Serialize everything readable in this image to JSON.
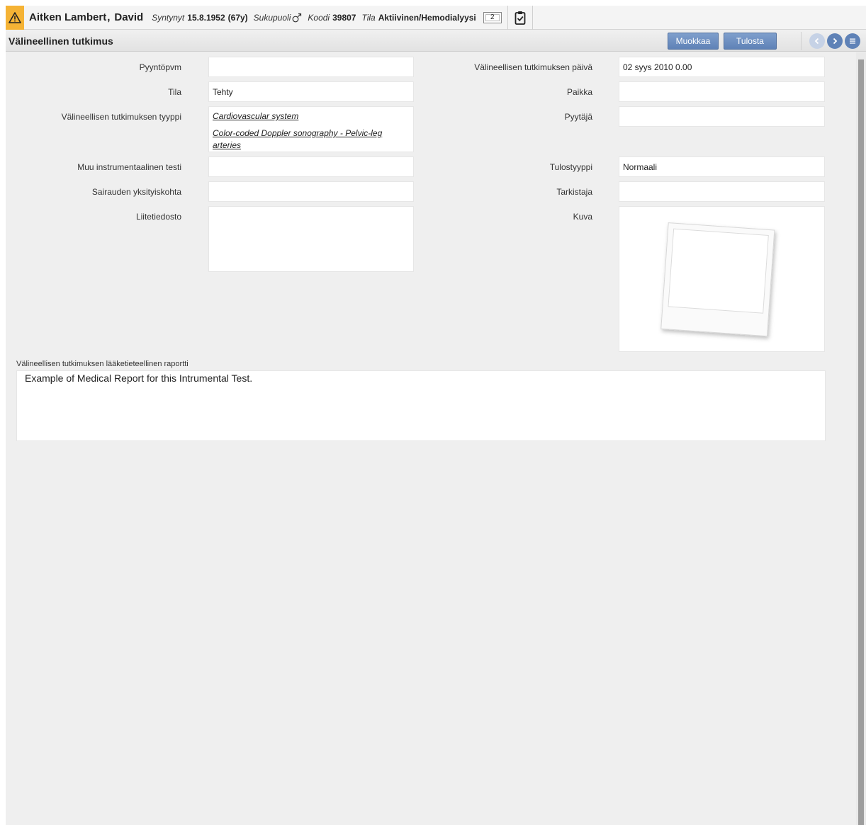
{
  "patient": {
    "name": "Aitken Lambert",
    "first_name": "David",
    "born_label": "Syntynyt",
    "born_value": "15.8.1952",
    "age": "(67y)",
    "sex_label": "Sukupuoli",
    "code_label": "Koodi",
    "code_value": "39807",
    "status_label": "Tila",
    "status_value": "Aktiivinen/Hemodialyysi",
    "counter": "2"
  },
  "title_bar": {
    "title": "Välineellinen tutkimus",
    "edit_label": "Muokkaa",
    "print_label": "Tulosta"
  },
  "form": {
    "request_date_label": "Pyyntöpvm",
    "request_date_value": "",
    "exam_date_label": "Välineellisen tutkimuksen päivä",
    "exam_date_value": "02 syys 2010 0.00",
    "status_label": "Tila",
    "status_value": "Tehty",
    "place_label": "Paikka",
    "place_value": "",
    "type_label": "Välineellisen tutkimuksen tyyppi",
    "type_values": [
      "Cardiovascular system",
      "Color-coded Doppler sonography - Pelvic-leg",
      "arteries"
    ],
    "requester_label": "Pyytäjä",
    "requester_value": "",
    "other_test_label": "Muu instrumentaalinen testi",
    "other_test_value": "",
    "result_type_label": "Tulostyyppi",
    "result_type_value": "Normaali",
    "disease_detail_label": "Sairauden yksityiskohta",
    "disease_detail_value": "",
    "checker_label": "Tarkistaja",
    "checker_value": "",
    "attachment_label": "Liitetiedosto",
    "image_label": "Kuva",
    "report_label": "Välineellisen tutkimuksen lääketieteellinen raportti",
    "report_value": "Example of Medical Report for this Intrumental Test."
  },
  "colors": {
    "warning": "#f5b335",
    "button": "#6b8cbf",
    "nav_active": "#5f82b7",
    "nav_disabled": "#c6d2e6"
  },
  "icons": [
    "warning-icon",
    "male-icon",
    "clipboard-check-icon",
    "chevron-left-icon",
    "chevron-right-icon",
    "menu-icon",
    "photo-placeholder-icon"
  ]
}
